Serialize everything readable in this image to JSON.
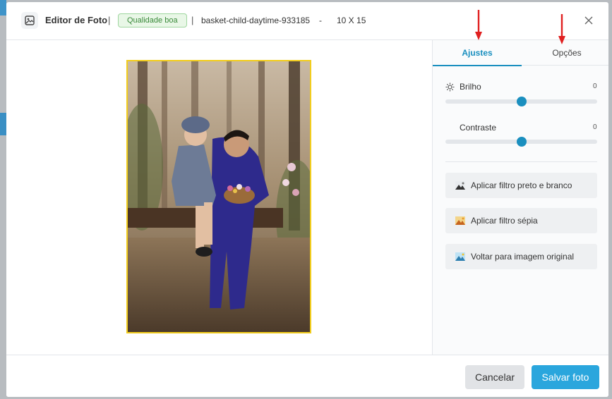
{
  "header": {
    "title": "Editor de Foto",
    "separator": "|",
    "quality_badge": "Qualidade boa",
    "filename": "basket-child-daytime-933185",
    "dash": "-",
    "print_size": "10 X 15"
  },
  "tabs": [
    {
      "label": "Ajustes",
      "active": true
    },
    {
      "label": "Opções",
      "active": false
    }
  ],
  "adjustments": {
    "brightness": {
      "label": "Brilho",
      "value": "0",
      "level": 0.5
    },
    "contrast": {
      "label": "Contraste",
      "value": "0",
      "level": 0.5
    }
  },
  "actions": [
    {
      "label": "Aplicar filtro preto e branco",
      "icon": "landscape-bw-icon"
    },
    {
      "label": "Aplicar filtro sépia",
      "icon": "landscape-sepia-icon"
    },
    {
      "label": "Voltar para imagem original",
      "icon": "landscape-original-icon"
    }
  ],
  "footer": {
    "cancel_label": "Cancelar",
    "save_label": "Salvar foto"
  },
  "colors": {
    "accent": "#1a8fbf",
    "save_button": "#2aa6dd",
    "photo_border": "#f2cd1c",
    "badge_green": "#3a8a3a",
    "annotation_arrow": "#e02020"
  }
}
